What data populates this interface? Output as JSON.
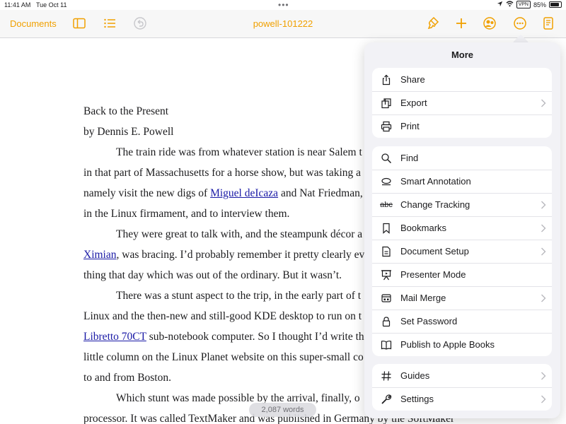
{
  "status_bar": {
    "time": "11:41 AM",
    "date": "Tue Oct 11",
    "dots": "•••",
    "vpn": "VPN",
    "battery": "85%",
    "battery_level": 0.85
  },
  "toolbar": {
    "documents_label": "Documents",
    "title": "powell-101222",
    "accent_color": "#f0a000",
    "icons": [
      "sidebar-icon",
      "list-icon",
      "undo-icon",
      "paintbrush-icon",
      "plus-icon",
      "collaborate-icon",
      "more-icon",
      "document-icon"
    ]
  },
  "document": {
    "lines": {
      "l1": "Back to the Present",
      "l2": "by Dennis E. Powell",
      "l3": "The train ride was from whatever station is near Salem t",
      "l4": "in that part of Massachusetts for a horse show, but was taking a",
      "l5_a": "namely visit the new digs of ",
      "l5_link": "Miguel deIcaza",
      "l5_b": " and Nat Friedman,",
      "l6": "in the Linux firmament, and to interview them.",
      "l7": "They were great to talk with, and the steampunk décor a",
      "l8_link": "Ximian",
      "l8_b": ", was bracing. I’d probably remember it pretty clearly ev",
      "l9": "thing that day which was out of the ordinary. But it wasn’t.",
      "l10": "There was a stunt aspect to the trip, in the early part of t",
      "l11": "Linux and the then-new and still-good KDE desktop to run on t",
      "l12_link": "Libretto 70CT",
      "l12_b": " sub-notebook computer. So I thought I’d write th",
      "l13": "little column on the Linux Planet website on this super-small co",
      "l14": "to and from Boston.",
      "l15": "Which stunt was made possible by the arrival, finally, o",
      "l16": "processor. It was called TextMaker and was published in Germany by the SoftMaker"
    },
    "word_count": "2,087 words"
  },
  "more_menu": {
    "title": "More",
    "group1": [
      {
        "label": "Share",
        "icon": "share-icon",
        "chevron": false
      },
      {
        "label": "Export",
        "icon": "export-icon",
        "chevron": true
      },
      {
        "label": "Print",
        "icon": "print-icon",
        "chevron": false
      }
    ],
    "group2": [
      {
        "label": "Find",
        "icon": "search-icon",
        "chevron": false
      },
      {
        "label": "Smart Annotation",
        "icon": "smart-annotation-icon",
        "chevron": false
      },
      {
        "label": "Change Tracking",
        "icon": "change-tracking-icon",
        "icon_text": "abc",
        "chevron": true
      },
      {
        "label": "Bookmarks",
        "icon": "bookmark-icon",
        "chevron": true
      },
      {
        "label": "Document Setup",
        "icon": "document-setup-icon",
        "chevron": true
      },
      {
        "label": "Presenter Mode",
        "icon": "presenter-icon",
        "chevron": false
      },
      {
        "label": "Mail Merge",
        "icon": "mail-merge-icon",
        "chevron": true
      },
      {
        "label": "Set Password",
        "icon": "lock-icon",
        "chevron": false
      },
      {
        "label": "Publish to Apple Books",
        "icon": "book-icon",
        "chevron": false
      }
    ],
    "group3": [
      {
        "label": "Guides",
        "icon": "guides-icon",
        "chevron": true
      },
      {
        "label": "Settings",
        "icon": "wrench-icon",
        "chevron": true
      }
    ]
  }
}
